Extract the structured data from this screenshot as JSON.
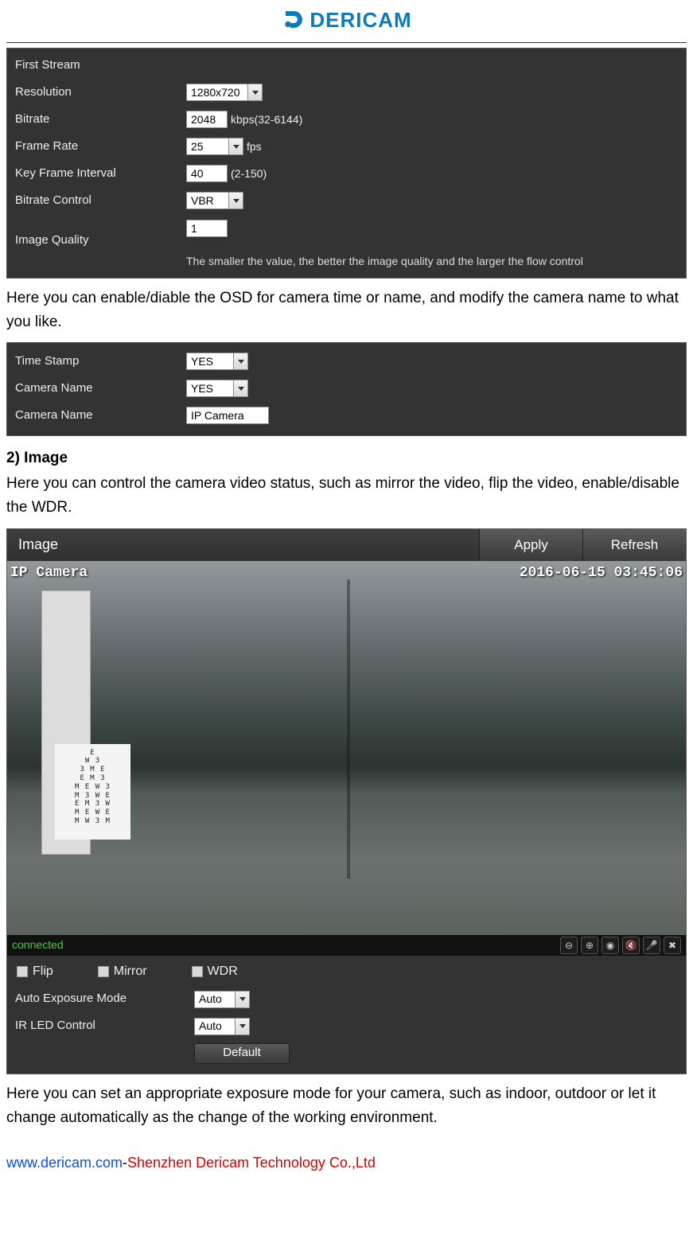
{
  "brand": {
    "name": "DERICAM"
  },
  "stream_panel": {
    "title": "First Stream",
    "rows": {
      "resolution": {
        "label": "Resolution",
        "value": "1280x720"
      },
      "bitrate": {
        "label": "Bitrate",
        "value": "2048",
        "suffix": "kbps(32-6144)"
      },
      "frame_rate": {
        "label": "Frame Rate",
        "value": "25",
        "suffix": "fps"
      },
      "key_frame": {
        "label": "Key Frame Interval",
        "value": "40",
        "suffix": "(2-150)"
      },
      "bitrate_ctrl": {
        "label": "Bitrate Control",
        "value": "VBR"
      },
      "image_quality": {
        "label": "Image Quality",
        "value": "1"
      }
    },
    "note": "The smaller the value, the better the image quality and the larger the flow control"
  },
  "text1": "Here you can enable/diable the OSD for camera time or name, and modify the camera name to what you like.",
  "osd_panel": {
    "rows": {
      "time_stamp": {
        "label": "Time Stamp",
        "value": "YES"
      },
      "cam_name_toggle": {
        "label": "Camera Name",
        "value": "YES"
      },
      "cam_name_value": {
        "label": "Camera Name",
        "value": "IP Camera"
      }
    }
  },
  "section2": {
    "heading": "2) Image",
    "text": "Here you can control the camera video status, such as mirror the video, flip the video, enable/disable the WDR."
  },
  "image_panel": {
    "title": "Image",
    "apply": "Apply",
    "refresh": "Refresh",
    "osd_name": "IP Camera",
    "osd_time": "2016-06-15 03:45:06",
    "status": "connected",
    "checks": {
      "flip": "Flip",
      "mirror": "Mirror",
      "wdr": "WDR"
    },
    "exposure": {
      "label": "Auto Exposure Mode",
      "value": "Auto"
    },
    "irled": {
      "label": "IR LED Control",
      "value": "Auto"
    },
    "default_btn": "Default"
  },
  "text3": "Here you can set an appropriate exposure mode for your camera, such as indoor, outdoor or let it change automatically as the change of the working environment.",
  "footer": {
    "link": "www.dericam.com",
    "sep": "-",
    "company": "Shenzhen Dericam Technology Co.,Ltd"
  },
  "eye_chart_lines": [
    "E",
    "W 3",
    "3 M E",
    "E M 3",
    "M E W 3",
    "M 3 W E",
    "E M 3 W",
    "M E W E",
    "M W 3 M"
  ]
}
